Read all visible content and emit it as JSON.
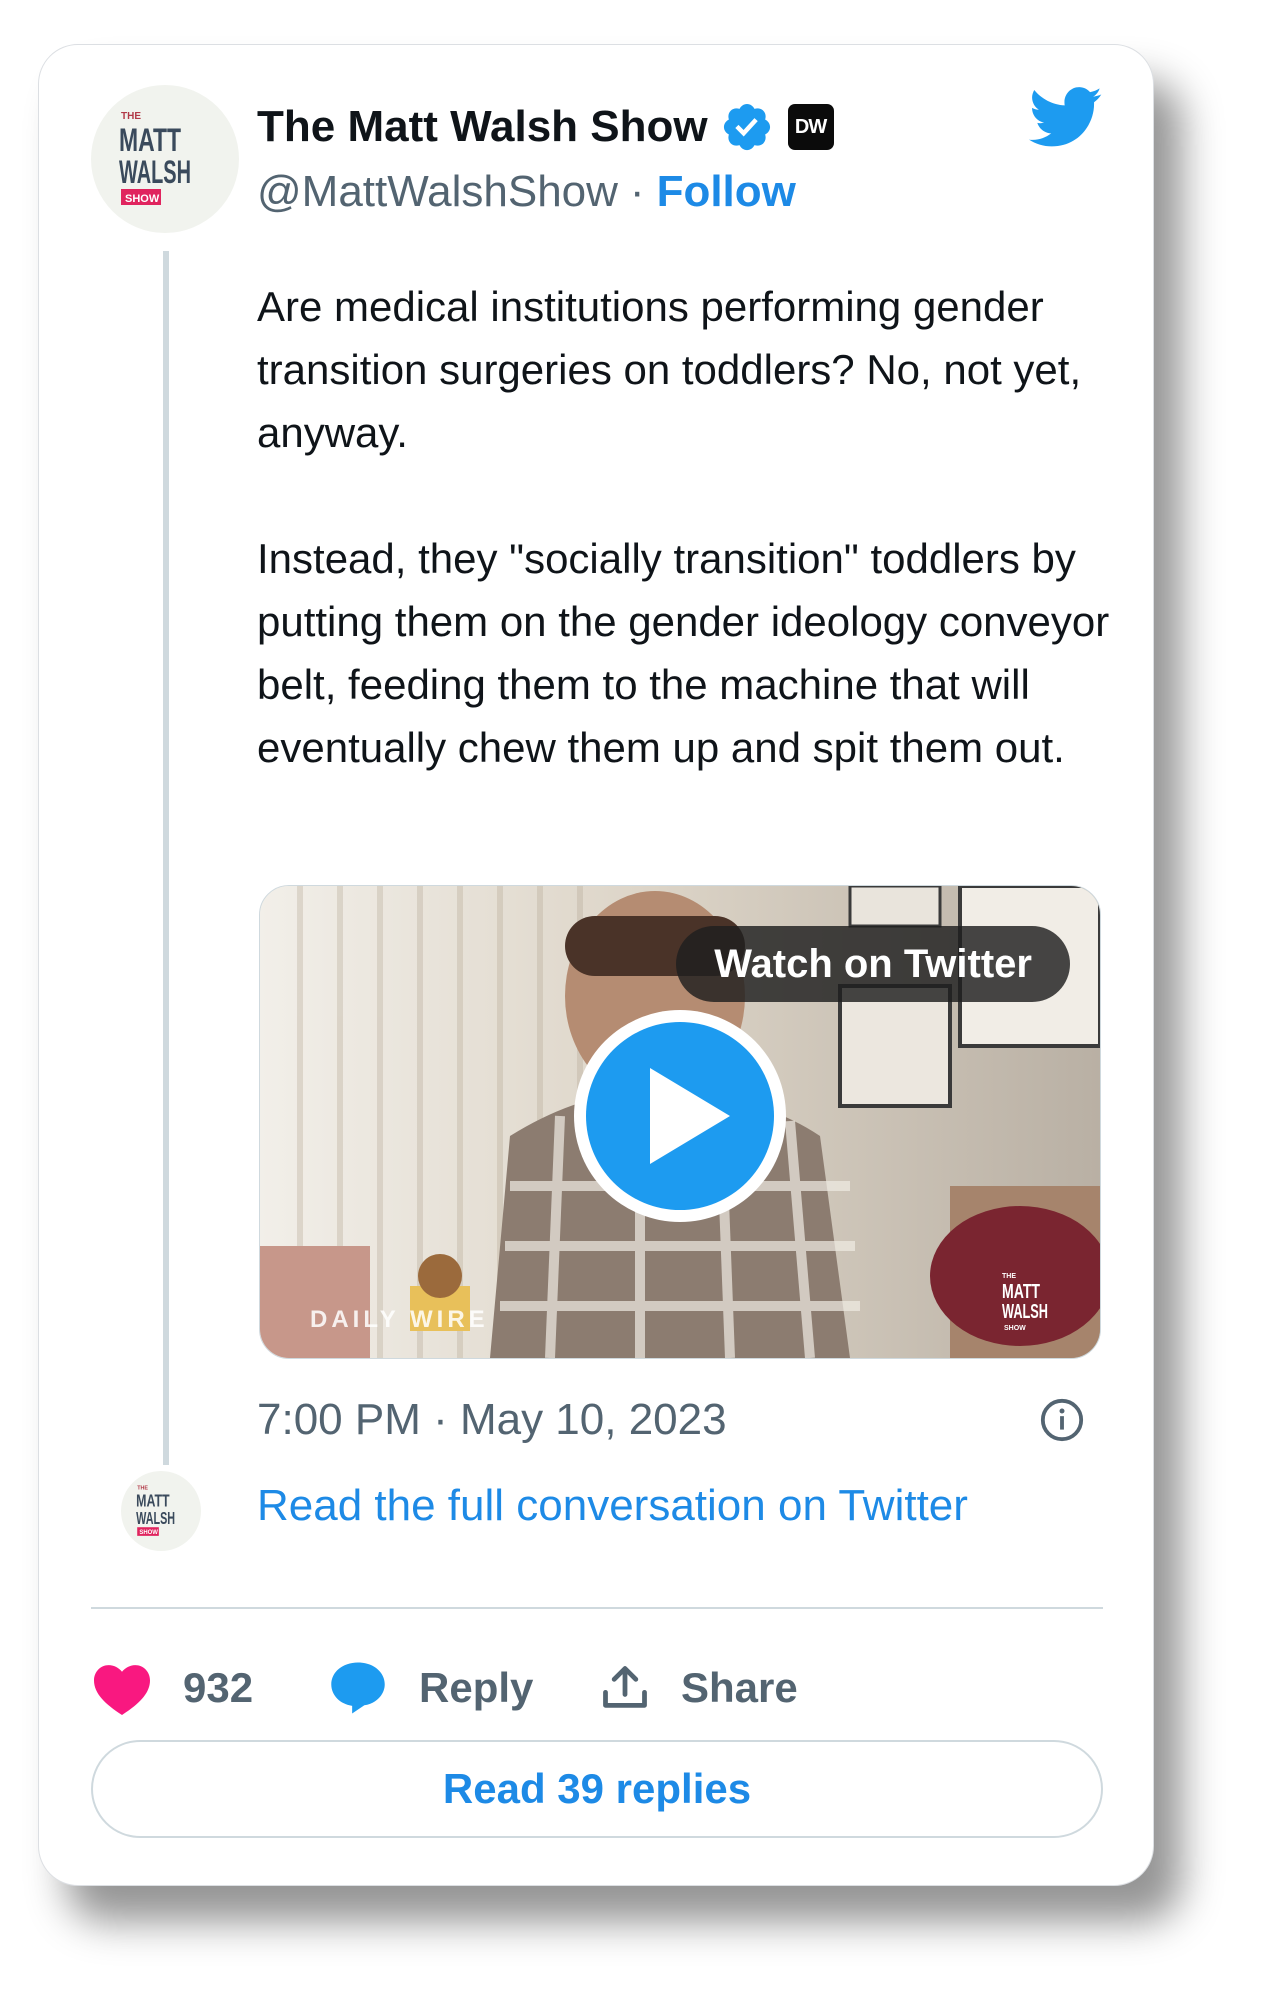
{
  "author": {
    "name": "The Matt Walsh Show",
    "handle": "@MattWalshShow",
    "separator": "·",
    "follow_label": "Follow",
    "affiliate_badge": "DW",
    "avatar_logo": {
      "top": "THE",
      "line1": "MATT",
      "line2": "WALSH",
      "line3": "SHOW"
    }
  },
  "tweet": {
    "text": "Are medical institutions performing gender transition surgeries on toddlers? No, not yet, anyway.\n\nInstead, they \"socially transition\" toddlers by putting them on the gender ideology conveyor belt, feeding them to the machine that will eventually chew them up and spit them out.",
    "timestamp": "7:00 PM · May 10, 2023"
  },
  "media": {
    "watch_label": "Watch on Twitter",
    "watermark_left": "DAILY WIRE",
    "watermark_right": {
      "top": "THE",
      "line1": "MATT",
      "line2": "WALSH",
      "line3": "SHOW"
    }
  },
  "conversation": {
    "read_full_label": "Read the full conversation on Twitter"
  },
  "actions": {
    "like_count": "932",
    "reply_label": "Reply",
    "share_label": "Share"
  },
  "read_replies_label": "Read 39 replies",
  "colors": {
    "accent": "#1d8ae6",
    "like": "#f91880",
    "verified": "#1d9bf0",
    "text": "#0f1419",
    "muted": "#536471"
  },
  "icons": [
    "verified-badge-icon",
    "twitter-bird-icon",
    "play-icon",
    "info-icon",
    "heart-icon",
    "reply-bubble-icon",
    "share-icon"
  ]
}
